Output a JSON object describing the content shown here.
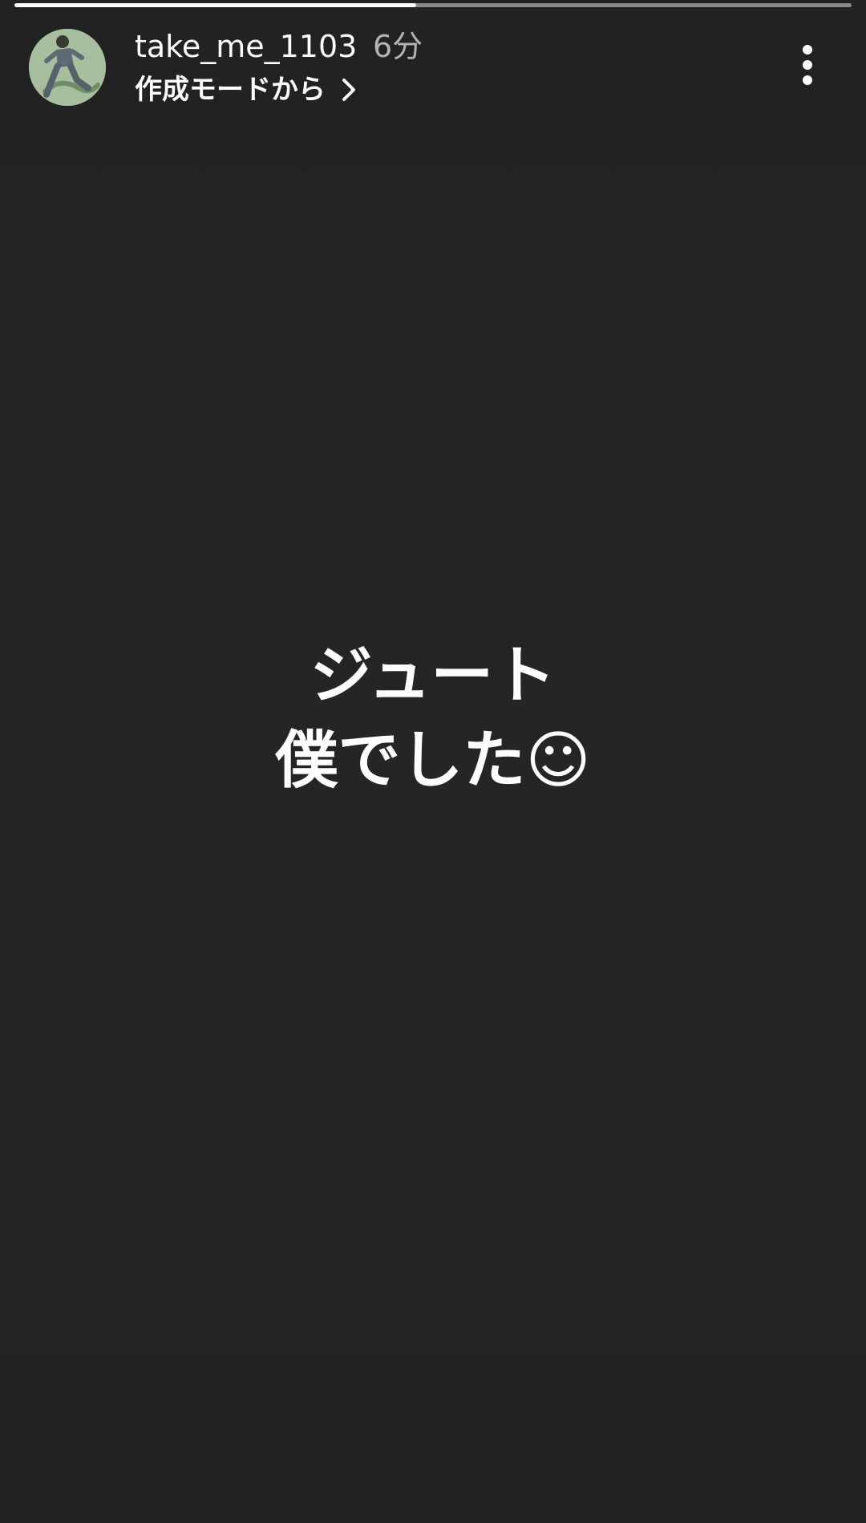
{
  "story": {
    "progress_fraction": 0.48,
    "username": "take_me_1103",
    "timestamp": "6分",
    "source_label": "作成モードから",
    "more_icon": "more-vertical-icon",
    "chevron_icon": "chevron-right-icon",
    "text_lines": [
      "ジュート",
      "僕でした☺"
    ],
    "colors": {
      "background": "#232323",
      "text": "#ffffff",
      "timestamp": "#b3b3b3",
      "progress_track": "#8a8a8a",
      "progress_fill": "#ffffff"
    }
  }
}
